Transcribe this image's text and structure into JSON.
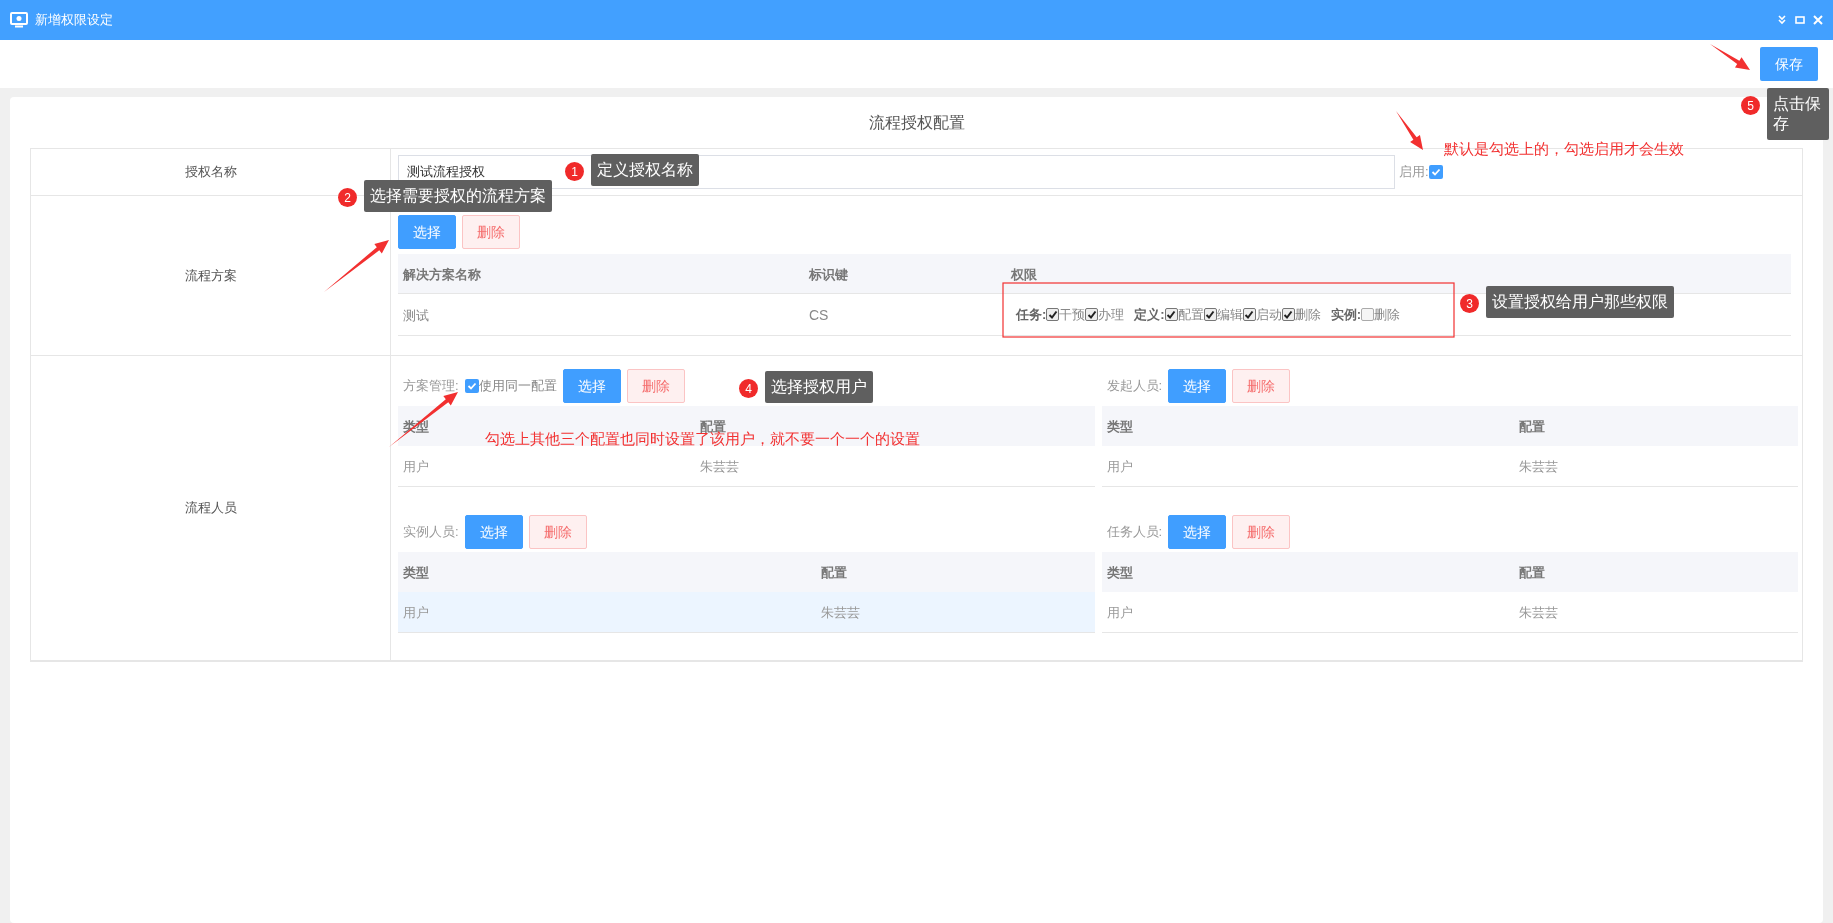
{
  "window": {
    "title": "新增权限设定"
  },
  "toolbar": {
    "save_button": "保存"
  },
  "form": {
    "title": "流程授权配置",
    "name_row": {
      "label": "授权名称",
      "value": "测试流程授权",
      "enabled_label": "启用:",
      "enabled": true
    },
    "scheme_row": {
      "label": "流程方案",
      "buttons": [
        {
          "label": "选择",
          "kind": "primary"
        },
        {
          "label": "删除",
          "kind": "danger"
        }
      ],
      "columns": [
        "解决方案名称",
        "标识键",
        "权限"
      ],
      "rows": [
        {
          "name": "测试",
          "key": "CS",
          "permissions": [
            {
              "group": "任务:",
              "options": [
                {
                  "label": "干预",
                  "checked": true
                },
                {
                  "label": "办理",
                  "checked": true
                }
              ]
            },
            {
              "group": "定义:",
              "options": [
                {
                  "label": "配置",
                  "checked": true
                },
                {
                  "label": "编辑",
                  "checked": true
                },
                {
                  "label": "启动",
                  "checked": true
                },
                {
                  "label": "删除",
                  "checked": true
                }
              ]
            },
            {
              "group": "实例:",
              "options": [
                {
                  "label": "删除",
                  "checked": false
                }
              ]
            }
          ]
        }
      ]
    },
    "people_row": {
      "label": "流程人员",
      "panels": [
        {
          "label": "方案管理:",
          "same_config": {
            "label": "使用同一配置",
            "checked": true
          },
          "buttons": [
            {
              "label": "选择",
              "kind": "primary"
            },
            {
              "label": "删除",
              "kind": "danger"
            }
          ],
          "columns": [
            "类型",
            "配置"
          ],
          "rows": [
            {
              "cells": [
                "用户",
                "朱芸芸"
              ],
              "selected": false
            }
          ]
        },
        {
          "label": "发起人员:",
          "buttons": [
            {
              "label": "选择",
              "kind": "primary"
            },
            {
              "label": "删除",
              "kind": "danger"
            }
          ],
          "columns": [
            "类型",
            "配置"
          ],
          "rows": [
            {
              "cells": [
                "用户",
                "朱芸芸"
              ],
              "selected": false
            }
          ]
        },
        {
          "label": "实例人员:",
          "buttons": [
            {
              "label": "选择",
              "kind": "primary"
            },
            {
              "label": "删除",
              "kind": "danger"
            }
          ],
          "columns": [
            "类型",
            "配置"
          ],
          "rows": [
            {
              "cells": [
                "用户",
                "朱芸芸"
              ],
              "selected": true
            }
          ]
        },
        {
          "label": "任务人员:",
          "buttons": [
            {
              "label": "选择",
              "kind": "primary"
            },
            {
              "label": "删除",
              "kind": "danger"
            }
          ],
          "columns": [
            "类型",
            "配置"
          ],
          "rows": [
            {
              "cells": [
                "用户",
                "朱芸芸"
              ],
              "selected": false
            }
          ]
        }
      ]
    }
  },
  "annotations": [
    {
      "number": "1",
      "text": "定义授权名称"
    },
    {
      "number": "2",
      "text": "选择需要授权的流程方案"
    },
    {
      "number": "3",
      "text": "设置授权给用户那些权限"
    },
    {
      "number": "4",
      "text": "选择授权用户"
    },
    {
      "number": "5",
      "text": "点击保存"
    }
  ],
  "notes": [
    "默认是勾选上的，勾选启用才会生效",
    "勾选上其他三个配置也同时设置了该用户，就不要一个一个的设置"
  ]
}
